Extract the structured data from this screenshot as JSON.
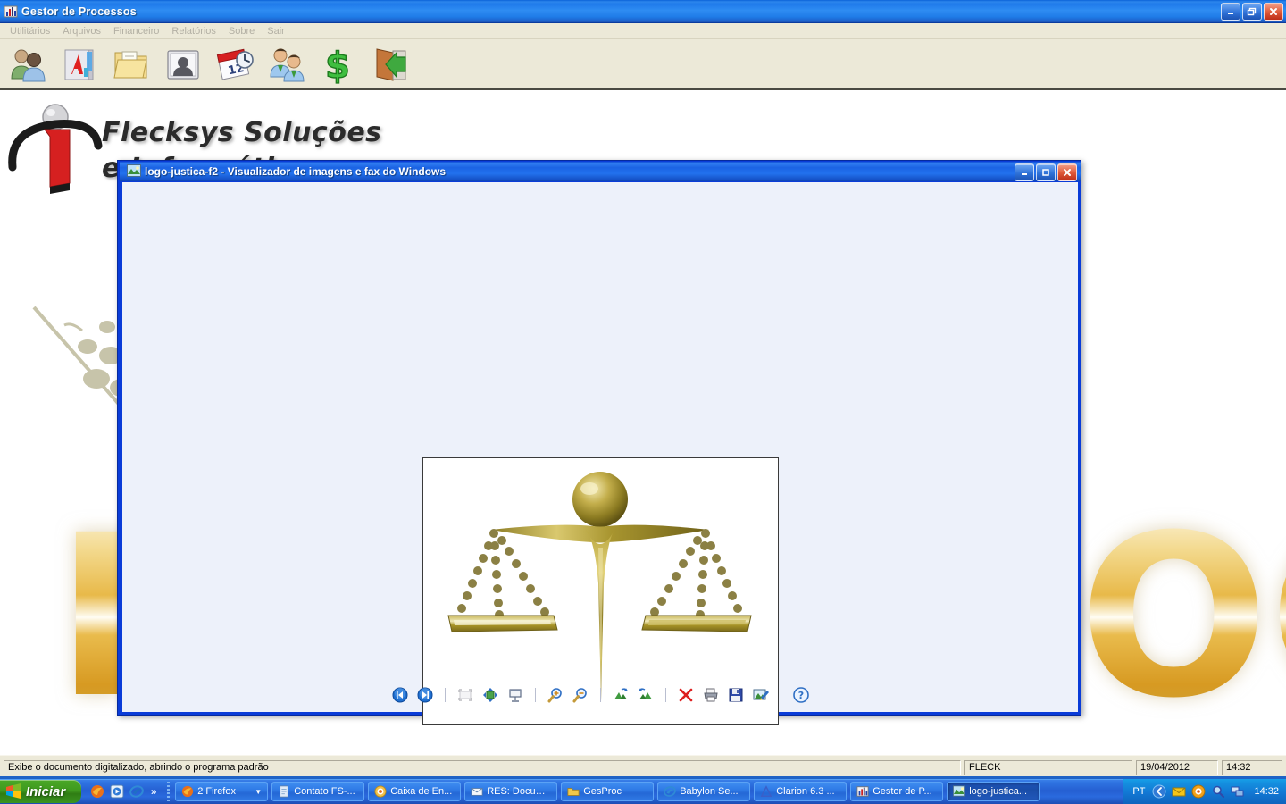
{
  "app": {
    "title": "Gestor de Processos",
    "icon": "bar-chart-icon",
    "window_buttons": [
      {
        "name": "minimize-button",
        "glyph": "_"
      },
      {
        "name": "restore-button",
        "glyph": "❐"
      },
      {
        "name": "close-button",
        "glyph": "✕"
      }
    ],
    "menu": [
      {
        "label": "Utilitários"
      },
      {
        "label": "Arquivos"
      },
      {
        "label": "Financeiro"
      },
      {
        "label": "Relatórios"
      },
      {
        "label": "Sobre"
      },
      {
        "label": "Sair"
      }
    ],
    "toolbar": [
      {
        "name": "clientes-icon",
        "title": "Clientes"
      },
      {
        "name": "documentos-icon",
        "title": "Documentos"
      },
      {
        "name": "pasta-icon",
        "title": "Pastas"
      },
      {
        "name": "contato-icon",
        "title": "Contatos"
      },
      {
        "name": "agenda-icon",
        "title": "Agenda"
      },
      {
        "name": "usuarios-icon",
        "title": "Usuários"
      },
      {
        "name": "financeiro-icon",
        "title": "Financeiro"
      },
      {
        "name": "sair-icon",
        "title": "Sair"
      }
    ]
  },
  "desktop": {
    "brand_line1": "Flecksys Soluções",
    "brand_line2": "e Informática",
    "watermark_left": "F",
    "watermark_right": "OC",
    "background_color": "#ffffff"
  },
  "status_bar": {
    "hint": "Exibe o documento digitalizado, abrindo o programa padrão",
    "user": "FLECK",
    "date": "19/04/2012",
    "time": "14:32"
  },
  "viewer": {
    "title": "logo-justica-f2 - Visualizador de imagens e fax do Windows",
    "icon": "picture-icon",
    "window_buttons": [
      {
        "name": "viewer-minimize-button",
        "glyph": "_"
      },
      {
        "name": "viewer-restore-button",
        "glyph": "❐"
      },
      {
        "name": "viewer-close-button",
        "glyph": "✕"
      }
    ],
    "image_alt": "logo-justica-f2",
    "toolbar": [
      {
        "name": "previous-image-button",
        "title": "Imagem anterior",
        "kind": "prev"
      },
      {
        "name": "next-image-button",
        "title": "Próxima imagem",
        "kind": "next"
      },
      {
        "name": "separator",
        "kind": "sep"
      },
      {
        "name": "best-fit-button",
        "title": "Melhor ajuste",
        "kind": "bestfit"
      },
      {
        "name": "actual-size-button",
        "title": "Tamanho real",
        "kind": "actual"
      },
      {
        "name": "slideshow-button",
        "title": "Apresentação de slides",
        "kind": "slideshow"
      },
      {
        "name": "separator",
        "kind": "sep"
      },
      {
        "name": "zoom-in-button",
        "title": "Ampliar",
        "kind": "zoomin"
      },
      {
        "name": "zoom-out-button",
        "title": "Reduzir",
        "kind": "zoomout"
      },
      {
        "name": "separator",
        "kind": "sep"
      },
      {
        "name": "rotate-left-button",
        "title": "Girar à esquerda",
        "kind": "rotleft"
      },
      {
        "name": "rotate-right-button",
        "title": "Girar à direita",
        "kind": "rotright"
      },
      {
        "name": "separator",
        "kind": "sep"
      },
      {
        "name": "delete-button",
        "title": "Excluir",
        "kind": "delete"
      },
      {
        "name": "print-button",
        "title": "Imprimir",
        "kind": "print"
      },
      {
        "name": "save-button",
        "title": "Salvar como",
        "kind": "save"
      },
      {
        "name": "edit-image-button",
        "title": "Editar imagem",
        "kind": "edit"
      },
      {
        "name": "separator",
        "kind": "sep"
      },
      {
        "name": "help-button",
        "title": "Ajuda",
        "kind": "help"
      }
    ]
  },
  "taskbar": {
    "start_label": "Iniciar",
    "quick_launch": [
      {
        "name": "quicklaunch-firefox-icon"
      },
      {
        "name": "quicklaunch-media-icon"
      },
      {
        "name": "quicklaunch-internet-explorer-icon"
      },
      {
        "name": "quicklaunch-more-icon",
        "glyph": "»"
      }
    ],
    "buttons": [
      {
        "label": "2 Firefox",
        "icon": "firefox-icon",
        "active": false,
        "group": true
      },
      {
        "label": "Contato FS-...",
        "icon": "document-icon",
        "active": false
      },
      {
        "label": "Caixa de En...",
        "icon": "mail-icon",
        "active": false
      },
      {
        "label": "RES: Docum...",
        "icon": "envelope-icon",
        "active": false
      },
      {
        "label": "GesProc",
        "icon": "folder-icon",
        "active": false
      },
      {
        "label": "Babylon Se...",
        "icon": "internet-explorer-icon",
        "active": false
      },
      {
        "label": "Clarion 6.3 ...",
        "icon": "clarion-icon",
        "active": false
      },
      {
        "label": "Gestor de P...",
        "icon": "bar-chart-icon",
        "active": false
      },
      {
        "label": "logo-justica...",
        "icon": "picture-icon",
        "active": true
      }
    ],
    "tray": {
      "language": "PT",
      "icons": [
        {
          "name": "tray-show-hidden-icon"
        },
        {
          "name": "tray-mail-icon"
        },
        {
          "name": "tray-antivirus-icon"
        },
        {
          "name": "tray-search-icon"
        },
        {
          "name": "tray-network-icon"
        }
      ],
      "clock": "14:32"
    }
  }
}
